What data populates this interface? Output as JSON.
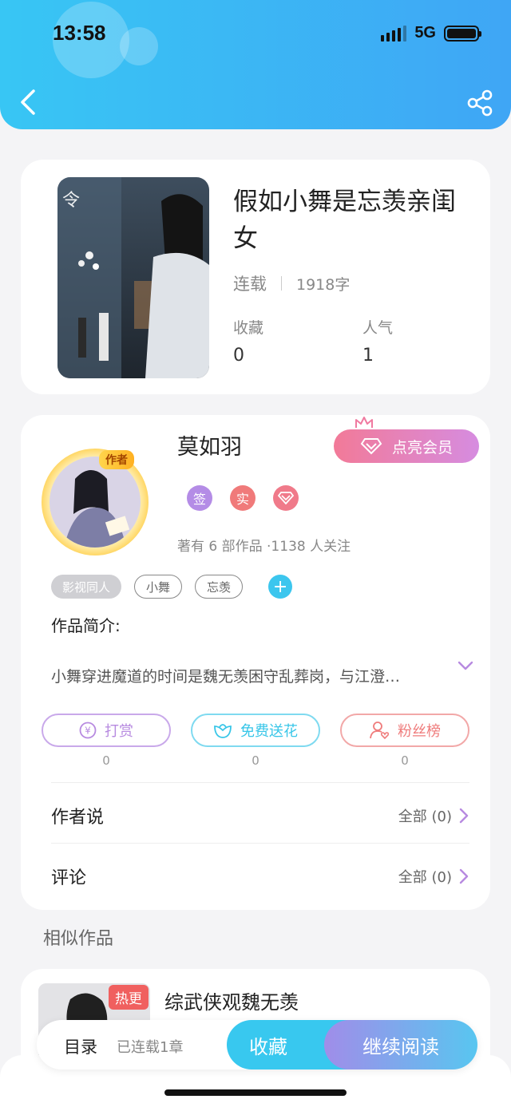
{
  "status_bar": {
    "time": "13:58",
    "network": "5G"
  },
  "book": {
    "title": "假如小舞是忘羡亲闺女",
    "status": "连载",
    "word_count": "1918字",
    "stats": [
      {
        "label": "收藏",
        "value": "0"
      },
      {
        "label": "人气",
        "value": "1"
      }
    ]
  },
  "author": {
    "name": "莫如羽",
    "badge": "作者",
    "vip_button": "点亮会员",
    "badges": [
      {
        "text": "签",
        "color": "#b48ce6"
      },
      {
        "text": "实",
        "color": "#f07a7a"
      }
    ],
    "stats": "著有 6 部作品 ·1138 人关注"
  },
  "tags": [
    "影视同人",
    "小舞",
    "忘羡"
  ],
  "intro": {
    "label": "作品简介:",
    "text": "小舞穿进魔道的时间是魏无羡困守乱葬岗，与江澄…"
  },
  "actions": [
    {
      "label": "打赏",
      "count": "0",
      "color": "#b78ae0"
    },
    {
      "label": "免费送花",
      "count": "0",
      "color": "#38c6e8"
    },
    {
      "label": "粉丝榜",
      "count": "0",
      "color": "#ef7c7c"
    }
  ],
  "rows": [
    {
      "title": "作者说",
      "more": "全部 (0)"
    },
    {
      "title": "评论",
      "more": "全部 (0)"
    }
  ],
  "similar": {
    "section_title": "相似作品",
    "items": [
      {
        "badge": "热更",
        "title": "综武侠观魏无羡"
      }
    ]
  },
  "bottom_bar": {
    "toc": "目录",
    "toc_status": "已连载1章",
    "favorite": "收藏",
    "continue": "继续阅读"
  }
}
